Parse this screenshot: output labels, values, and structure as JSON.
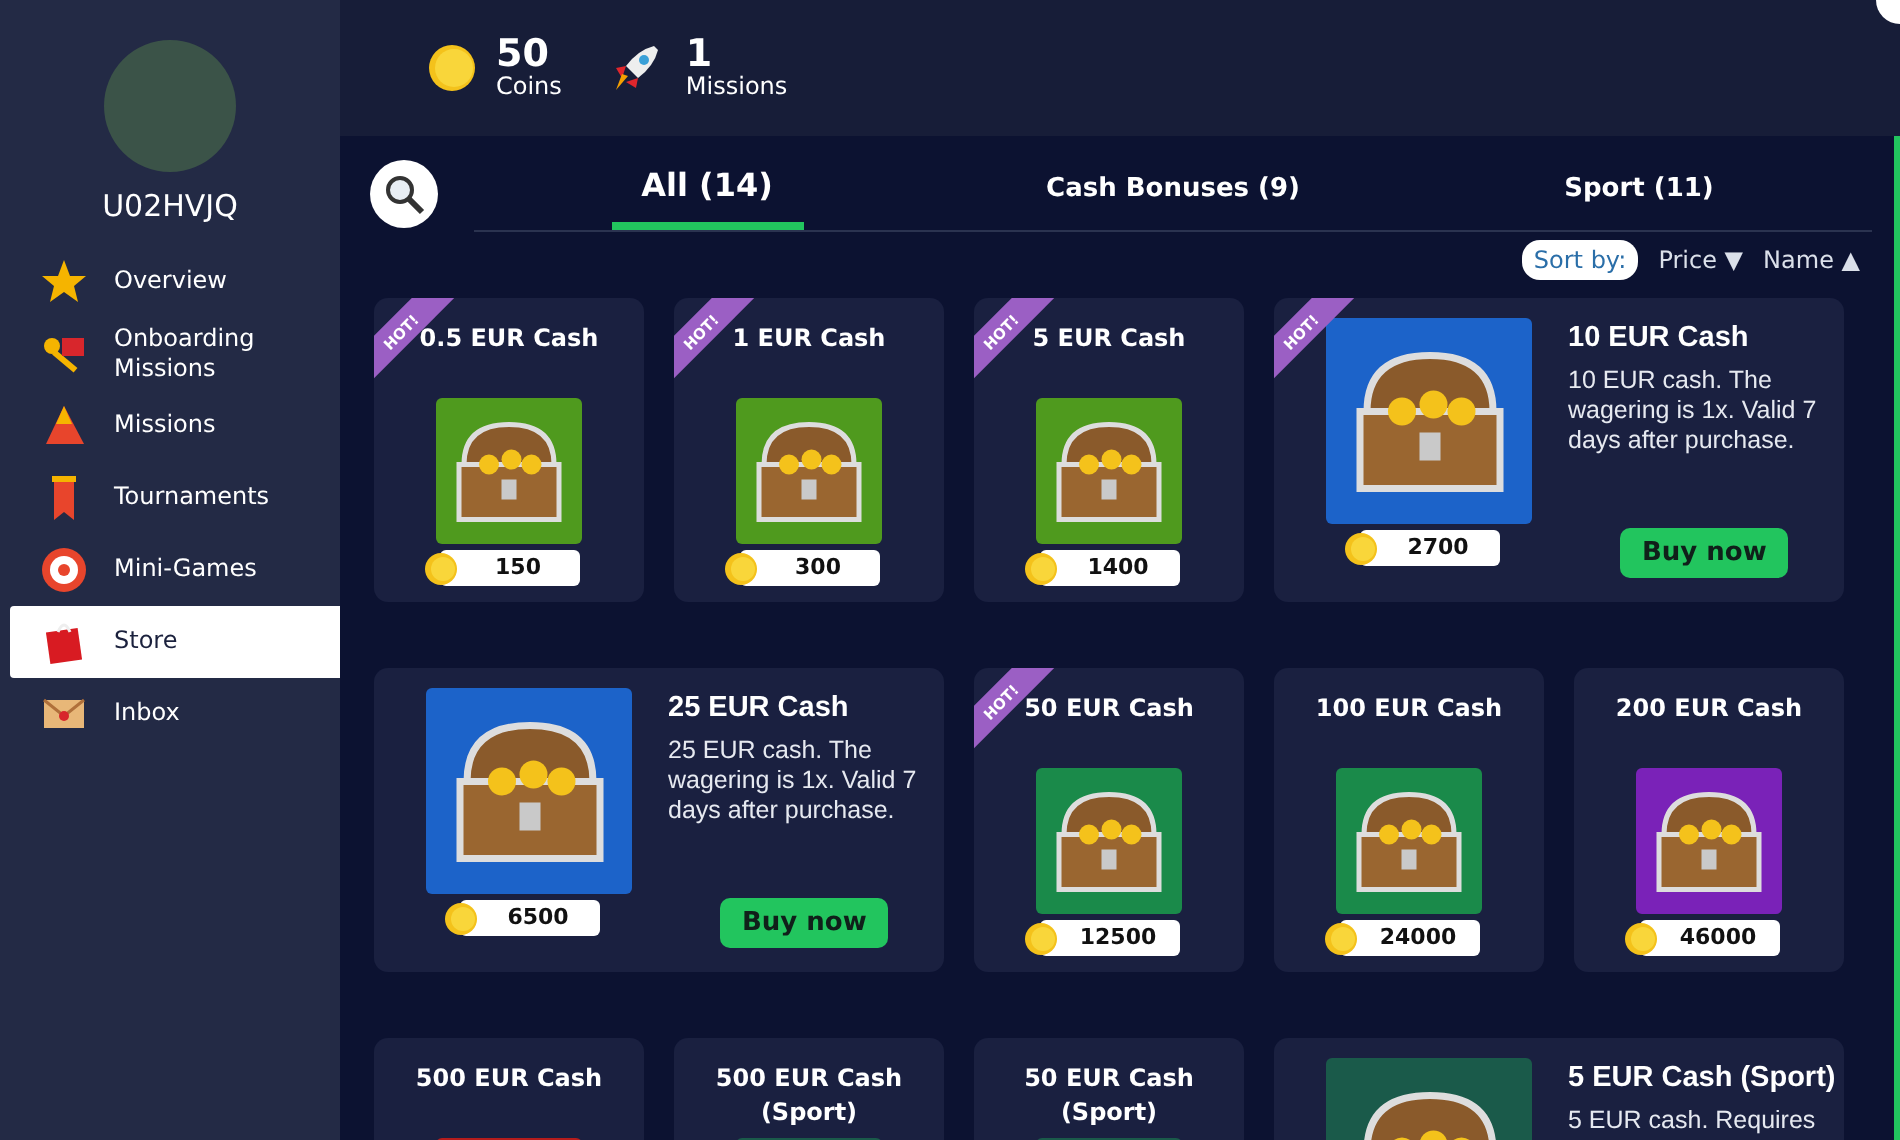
{
  "header": {
    "stats": [
      {
        "value": "50",
        "label": "Coins"
      },
      {
        "value": "1",
        "label": "Missions"
      }
    ]
  },
  "profile": {
    "username": "U02HVJQ"
  },
  "sidebar": {
    "items": [
      {
        "label": "Overview",
        "selected": false
      },
      {
        "label": "Onboarding Missions",
        "selected": false
      },
      {
        "label": "Missions",
        "selected": false
      },
      {
        "label": "Tournaments",
        "selected": false
      },
      {
        "label": "Mini-Games",
        "selected": false
      },
      {
        "label": "Store",
        "selected": true
      },
      {
        "label": "Inbox",
        "selected": false
      }
    ]
  },
  "tabs": [
    {
      "label": "All (14)",
      "selected": true
    },
    {
      "label": "Cash Bonuses (9)",
      "selected": false
    },
    {
      "label": "Sport (11)",
      "selected": false
    }
  ],
  "sort": {
    "label": "Sort by:",
    "options": [
      {
        "label": "Price",
        "arrow": "▼"
      },
      {
        "label": "Name",
        "arrow": "▲"
      }
    ]
  },
  "store_items": [
    {
      "kind": "tile",
      "title": "0.5 EUR Cash",
      "hot": true,
      "hot_label": "HOT!",
      "color": "#4f9a1e",
      "price": "150"
    },
    {
      "kind": "tile",
      "title": "1 EUR Cash",
      "hot": true,
      "hot_label": "HOT!",
      "color": "#4f9a1e",
      "price": "300"
    },
    {
      "kind": "tile",
      "title": "5 EUR Cash",
      "hot": true,
      "hot_label": "HOT!",
      "color": "#4f9a1e",
      "price": "1400"
    },
    {
      "kind": "wide",
      "title": "10 EUR Cash",
      "hot": true,
      "hot_label": "HOT!",
      "color": "#1c63c9",
      "price": "2700",
      "description": "10 EUR cash. The wagering is 1x. Valid 7 days after purchase.",
      "button": "Buy now"
    },
    {
      "kind": "wide",
      "title": "25 EUR Cash",
      "hot": false,
      "color": "#1c63c9",
      "price": "6500",
      "description": "25 EUR cash. The wagering is 1x. Valid 7 days after purchase.",
      "button": "Buy now"
    },
    {
      "kind": "tile",
      "title": "50 EUR Cash",
      "hot": true,
      "hot_label": "HOT!",
      "color": "#1a8a4a",
      "price": "12500"
    },
    {
      "kind": "tile",
      "title": "100 EUR Cash",
      "hot": false,
      "color": "#1a8a4a",
      "price": "24000"
    },
    {
      "kind": "tile",
      "title": "200 EUR Cash",
      "hot": false,
      "color": "#7a22b8",
      "price": "46000"
    },
    {
      "kind": "tile",
      "title": "500 EUR Cash",
      "hot": false,
      "color": "#b51c1c"
    },
    {
      "kind": "tile",
      "title": "500 EUR Cash (Sport)",
      "hot": false,
      "color": "#1a5a4a"
    },
    {
      "kind": "tile",
      "title": "50 EUR Cash (Sport)",
      "hot": false,
      "color": "#1a5a4a"
    },
    {
      "kind": "wide",
      "title": "5 EUR Cash (Sport)",
      "hot": false,
      "color": "#1a5a4a",
      "description": "5 EUR cash. Requires"
    }
  ]
}
